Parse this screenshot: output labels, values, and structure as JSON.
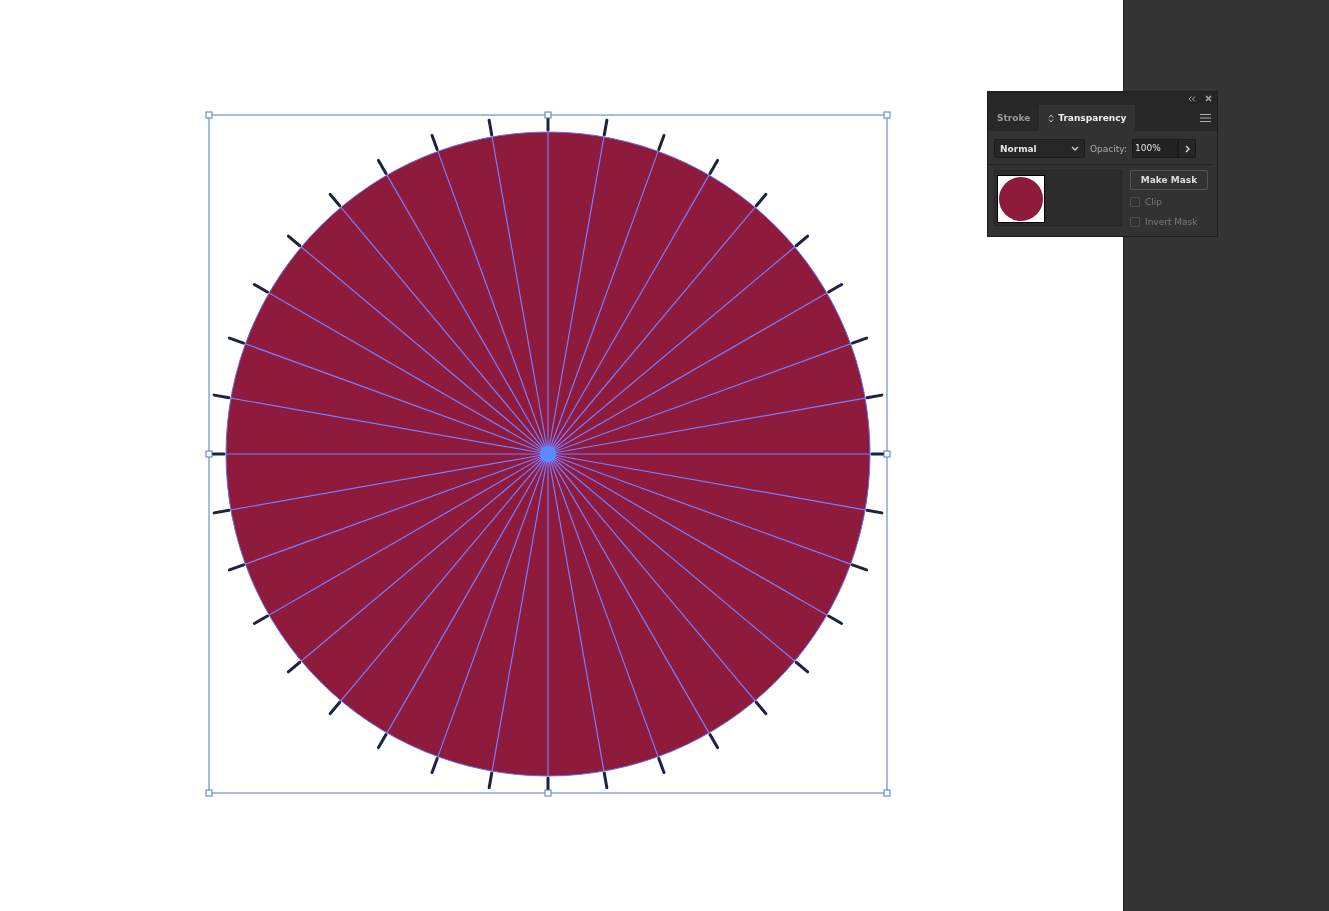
{
  "panel": {
    "tabs": [
      {
        "label": "Stroke",
        "selected": false
      },
      {
        "label": "Transparency",
        "selected": true
      }
    ],
    "blend_mode": "Normal",
    "opacity_label": "Opacity:",
    "opacity_value": "100%",
    "make_mask": "Make Mask",
    "options": [
      {
        "label": "Clip",
        "checked": false,
        "disabled": true
      },
      {
        "label": "Invert Mask",
        "checked": false,
        "disabled": true
      }
    ]
  }
}
